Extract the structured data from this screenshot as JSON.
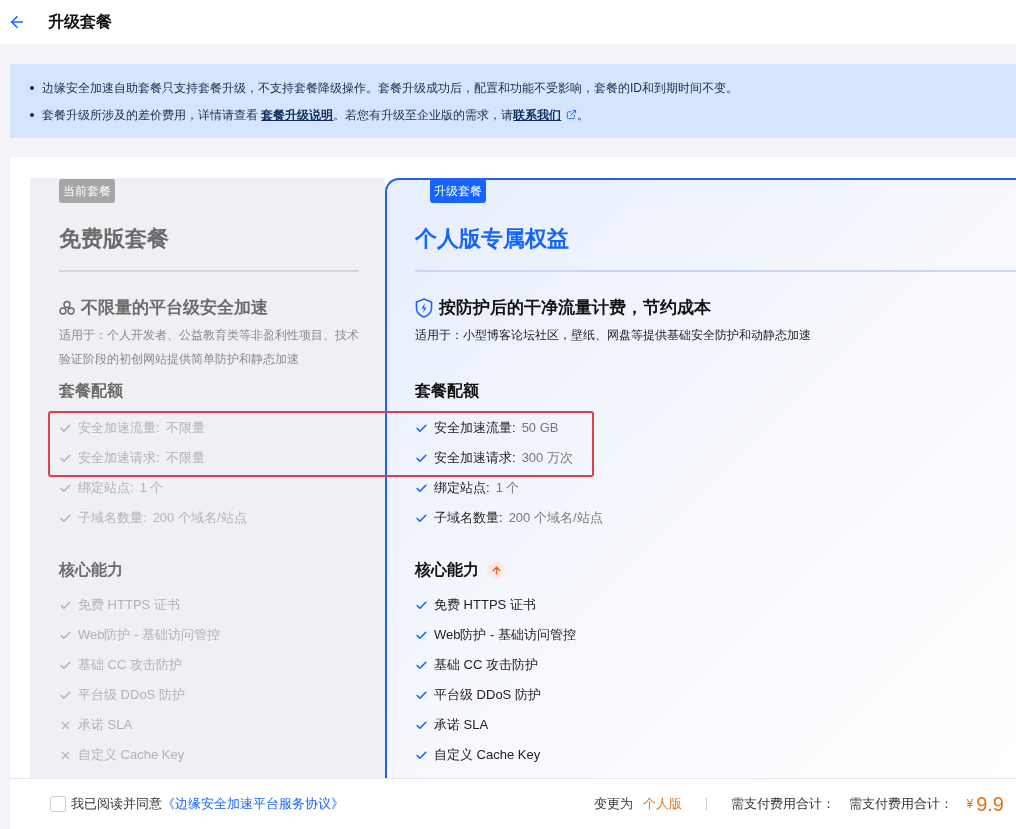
{
  "header": {
    "title": "升级套餐"
  },
  "notices": [
    {
      "segments": [
        {
          "kind": "text",
          "text": "边缘安全加速自助套餐只支持套餐升级，不支持套餐降级操作。套餐升级成功后，配置和功能不受影响，套餐的ID和到期时间不变。"
        }
      ]
    },
    {
      "segments": [
        {
          "kind": "text",
          "text": "套餐升级所涉及的差价费用，详情请查看 "
        },
        {
          "kind": "link",
          "text": "套餐升级说明"
        },
        {
          "kind": "text",
          "text": "。若您有升级至企业版的需求，请"
        },
        {
          "kind": "external_link",
          "text": "联系我们"
        },
        {
          "kind": "text",
          "text": "。"
        }
      ]
    }
  ],
  "plans": [
    {
      "kind": "current",
      "badge": "当前套餐",
      "name": "免费版套餐",
      "feature_title": "不限量的平台级安全加速",
      "description": "适用于：个人开发者、公益教育类等非盈利性项目、技术验证阶段的初创网站提供简单防护和静态加速",
      "quota_title": "套餐配额",
      "quotas": [
        {
          "label": "安全加速流量:",
          "value": "不限量",
          "included": true
        },
        {
          "label": "安全加速请求:",
          "value": "不限量",
          "included": true
        },
        {
          "label": "绑定站点:",
          "value": "1 个",
          "included": true
        },
        {
          "label": "子域名数量:",
          "value": "200 个域名/站点",
          "included": true
        }
      ],
      "core_title": "核心能力",
      "core": [
        {
          "text": "免费 HTTPS 证书",
          "included": true
        },
        {
          "text": "Web防护 - 基础访问管控",
          "included": true
        },
        {
          "text": "基础 CC 攻击防护",
          "included": true
        },
        {
          "text": "平台级 DDoS 防护",
          "included": true
        },
        {
          "text": "承诺 SLA",
          "included": false
        },
        {
          "text": "自定义 Cache Key",
          "included": false
        }
      ]
    },
    {
      "kind": "upgrade",
      "badge": "升级套餐",
      "name": "个人版专属权益",
      "feature_title": "按防护后的干净流量计费，节约成本",
      "description": "适用于：小型博客论坛社区，壁纸、网盘等提供基础安全防护和动静态加速",
      "quota_title": "套餐配额",
      "quotas": [
        {
          "label": "安全加速流量:",
          "value": "50 GB",
          "included": true
        },
        {
          "label": "安全加速请求:",
          "value": "300 万次",
          "included": true
        },
        {
          "label": "绑定站点:",
          "value": "1 个",
          "included": true
        },
        {
          "label": "子域名数量:",
          "value": "200 个域名/站点",
          "included": true
        }
      ],
      "core_title": "核心能力",
      "core": [
        {
          "text": "免费 HTTPS 证书",
          "included": true
        },
        {
          "text": "Web防护 - 基础访问管控",
          "included": true
        },
        {
          "text": "基础 CC 攻击防护",
          "included": true
        },
        {
          "text": "平台级 DDoS 防护",
          "included": true
        },
        {
          "text": "承诺 SLA",
          "included": true
        },
        {
          "text": "自定义 Cache Key",
          "included": true
        }
      ]
    }
  ],
  "footer": {
    "agreement": {
      "checked": false,
      "text": "我已阅读并同意",
      "link": "《边缘安全加速平台服务协议》"
    },
    "change_label": "变更为",
    "change_value": "个人版",
    "cost_labels": [
      "需支付费用合计：",
      "需支付费用合计："
    ],
    "currency": "¥",
    "amount": "9.9"
  }
}
